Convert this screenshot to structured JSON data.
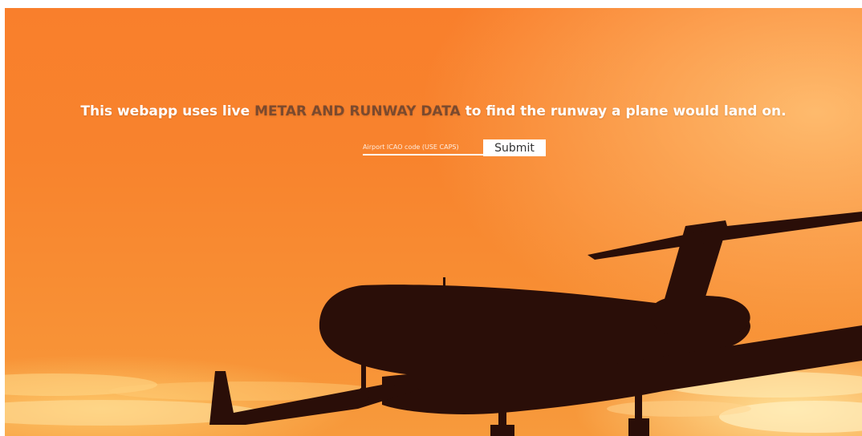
{
  "headline": {
    "prefix": "This webapp uses live ",
    "highlight": "METAR AND RUNWAY DATA",
    "suffix": " to find the runway a plane would land on."
  },
  "form": {
    "icao_placeholder": "Airport ICAO code (USE CAPS)",
    "icao_value": "",
    "submit_label": "Submit"
  },
  "colors": {
    "highlight": "#7b4a2e",
    "sky_top": "#f97f2c",
    "silhouette": "#2a0e08"
  },
  "background": {
    "icon": "airplane-silhouette-icon"
  }
}
